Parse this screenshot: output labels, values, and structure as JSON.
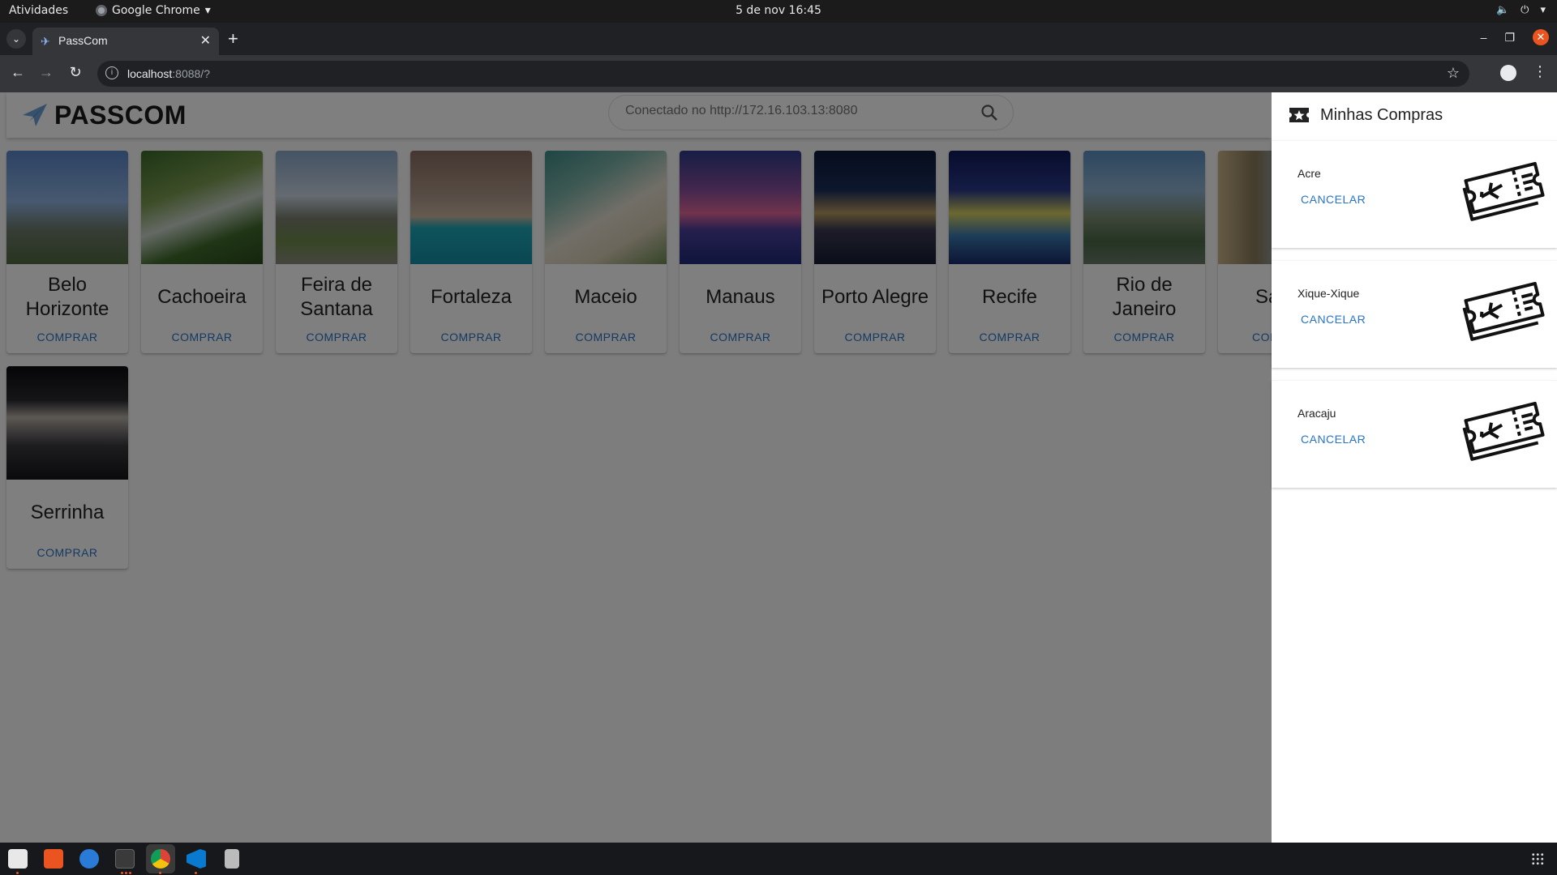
{
  "system": {
    "activities": "Atividades",
    "app_menu": "Google Chrome",
    "clock": "5 de nov  16:45"
  },
  "browser": {
    "tab_title": "PassCom",
    "url_host": "localhost",
    "url_rest": ":8088/?"
  },
  "app": {
    "brand": "PASSCOM",
    "search_placeholder": "Conectado no http://172.16.103.13:8080",
    "destinations": [
      {
        "name": "Belo Horizonte",
        "action": "COMPRAR"
      },
      {
        "name": "Cachoeira",
        "action": "COMPRAR"
      },
      {
        "name": "Feira de Santana",
        "action": "COMPRAR"
      },
      {
        "name": "Fortaleza",
        "action": "COMPRAR"
      },
      {
        "name": "Maceio",
        "action": "COMPRAR"
      },
      {
        "name": "Manaus",
        "action": "COMPRAR"
      },
      {
        "name": "Porto Alegre",
        "action": "COMPRAR"
      },
      {
        "name": "Recife",
        "action": "COMPRAR"
      },
      {
        "name": "Rio de Janeiro",
        "action": "COMPRAR"
      },
      {
        "name": "Salv",
        "action": "COM"
      },
      {
        "name": "Serrinha",
        "action": "COMPRAR"
      }
    ]
  },
  "drawer": {
    "title": "Minhas Compras",
    "purchases": [
      {
        "city": "Acre",
        "action": "CANCELAR"
      },
      {
        "city": "Xique-Xique",
        "action": "CANCELAR"
      },
      {
        "city": "Aracaju",
        "action": "CANCELAR"
      }
    ]
  },
  "colors": {
    "accent": "#2874c7",
    "overlay": "rgba(0,0,0,0.5)",
    "ubuntu_orange": "#e95420"
  }
}
